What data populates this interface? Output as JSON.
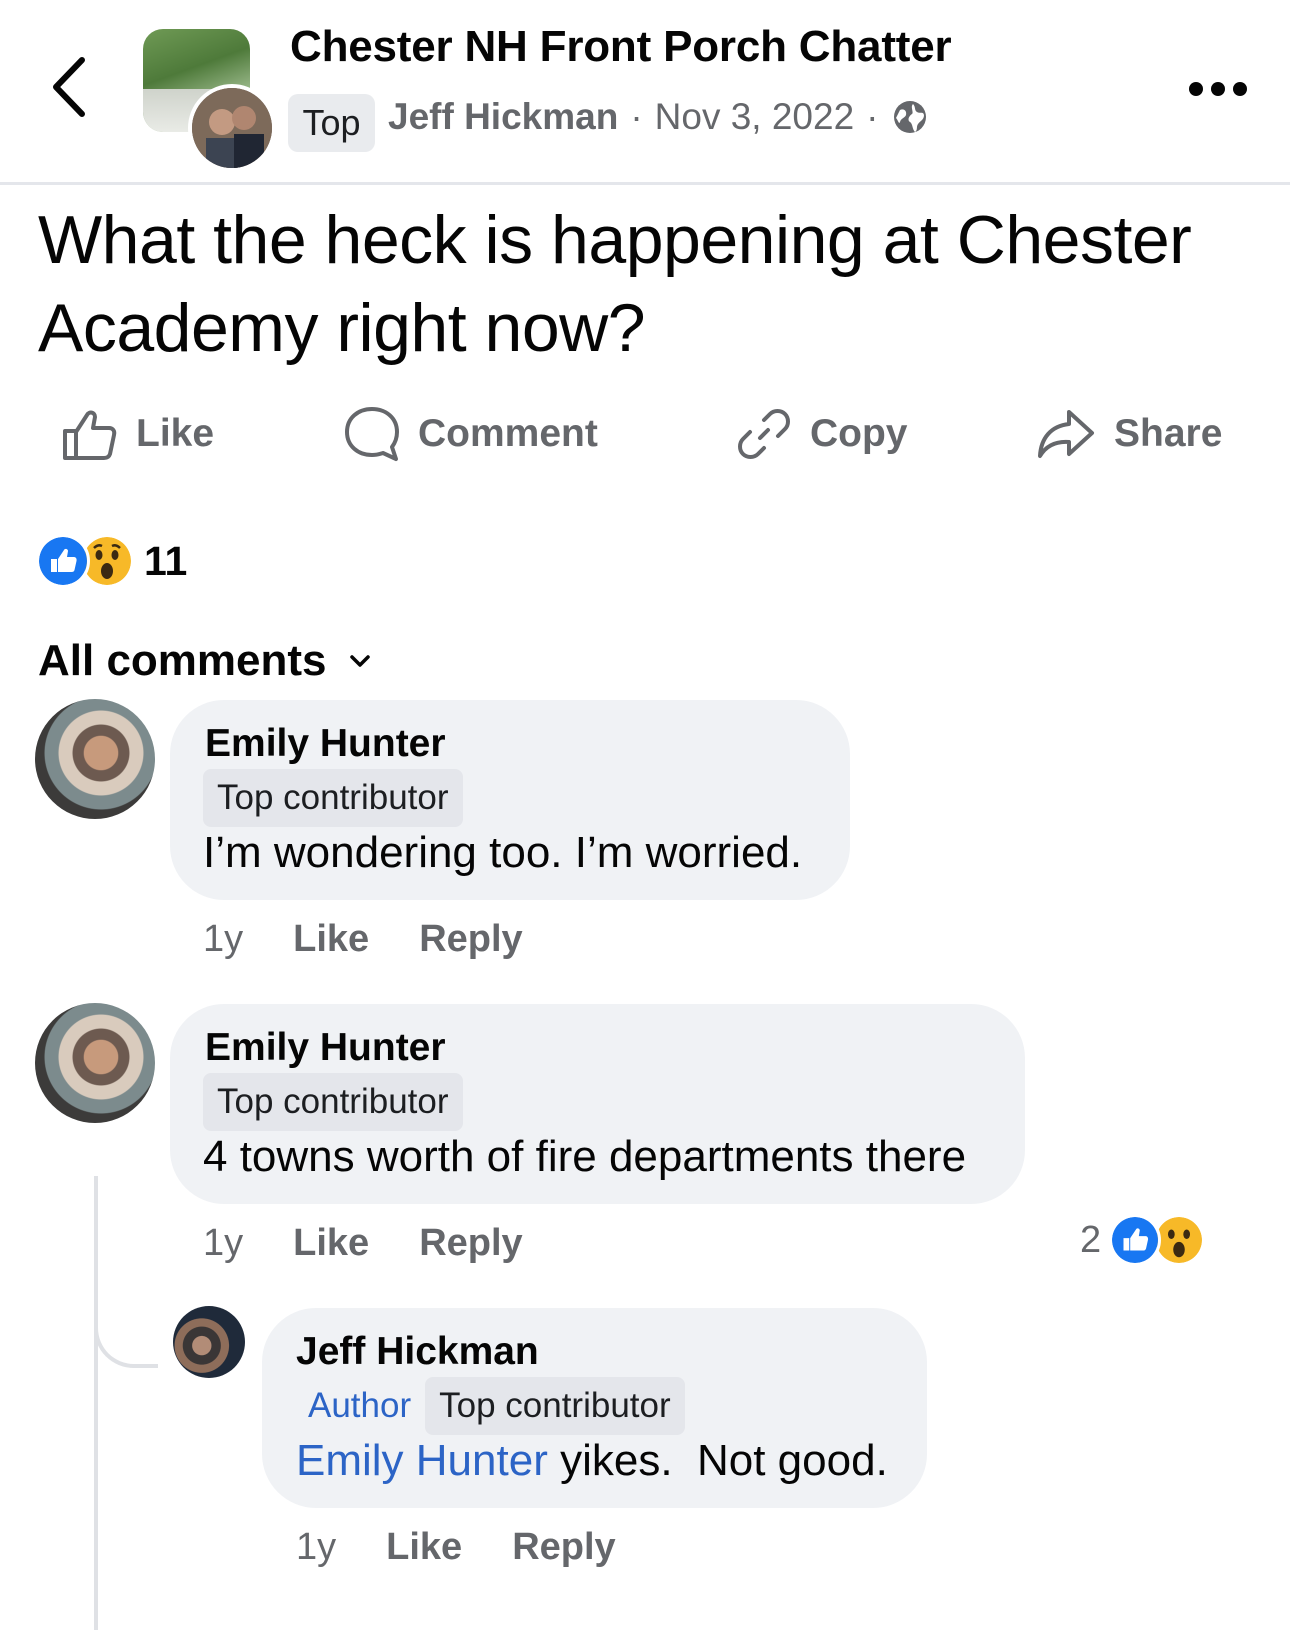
{
  "header": {
    "back_icon": "chevron-left-icon",
    "group_name": "Chester NH Front Porch Chatter",
    "badge": "Top",
    "author": "Jeff Hickman",
    "date": "Nov 3, 2022",
    "privacy_icon": "globe-icon",
    "more_icon": "more-icon"
  },
  "post": {
    "text": "What the heck is happening at Chester Academy right now?"
  },
  "actions": {
    "like": "Like",
    "comment": "Comment",
    "copy": "Copy",
    "share": "Share"
  },
  "reactions": {
    "count": "11",
    "types": [
      "like",
      "wow"
    ]
  },
  "comments_filter": {
    "label": "All comments"
  },
  "comments": [
    {
      "name": "Emily Hunter",
      "badges": [
        "Top contributor"
      ],
      "text": "I’m wondering too. I’m worried.",
      "time": "1y",
      "like": "Like",
      "reply": "Reply"
    },
    {
      "name": "Emily Hunter",
      "badges": [
        "Top contributor"
      ],
      "text": "4 towns worth of fire departments there",
      "time": "1y",
      "like": "Like",
      "reply": "Reply",
      "reaction_count": "2"
    }
  ],
  "reply": {
    "name": "Jeff Hickman",
    "badges": [
      "Author",
      "Top contributor"
    ],
    "mention": "Emily Hunter",
    "text": " yikes.  Not good.",
    "time": "1y",
    "like": "Like",
    "reply": "Reply"
  },
  "colors": {
    "link_blue": "#2c64c6",
    "like_blue": "#1877f2",
    "wow_yellow": "#f7b928",
    "secondary_text": "#65676b",
    "bubble_bg": "#f0f2f5"
  }
}
